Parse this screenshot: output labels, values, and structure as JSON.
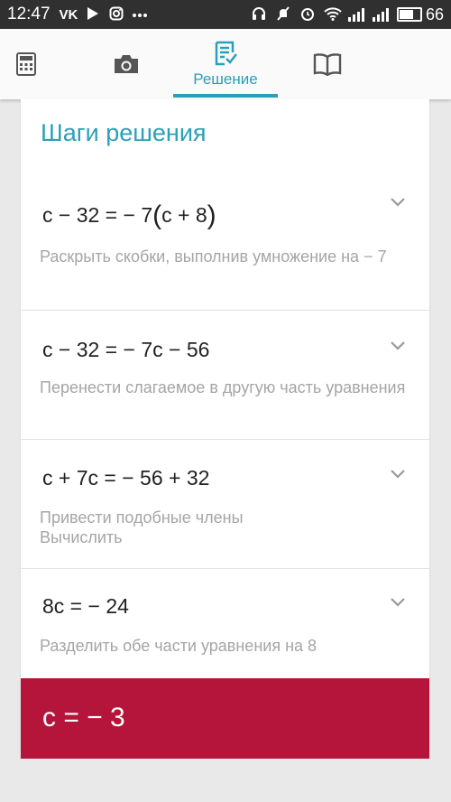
{
  "status_bar": {
    "time": "12:47",
    "battery": "66",
    "icons_left": [
      "vk-icon",
      "play-icon",
      "instagram-icon",
      "more-icon"
    ],
    "icons_right": [
      "headset-icon",
      "mute-icon",
      "alarm-icon",
      "wifi-icon",
      "signal-icon",
      "signal-icon",
      "battery-icon"
    ]
  },
  "tabs": {
    "active_label": "Решение",
    "accent": "#2aa0b8"
  },
  "solution": {
    "title": "Шаги решения",
    "steps": [
      {
        "eq_pre": "c − 32 = − 7",
        "eq_paren_open": "(",
        "eq_inner": "c + 8",
        "eq_paren_close": ")",
        "desc": "Раскрыть скобки, выполнив умножение на − 7"
      },
      {
        "equation": "c − 32 = − 7c − 56",
        "desc": "Перенести слагаемое в другую часть уравнения"
      },
      {
        "equation": "c + 7c = − 56 + 32",
        "desc_line1": "Привести подобные члены",
        "desc_line2": "Вычислить"
      },
      {
        "equation": "8c = − 24",
        "desc": "Разделить обе части уравнения на 8"
      }
    ],
    "answer": "c = − 3",
    "answer_color": "#b5153a"
  }
}
